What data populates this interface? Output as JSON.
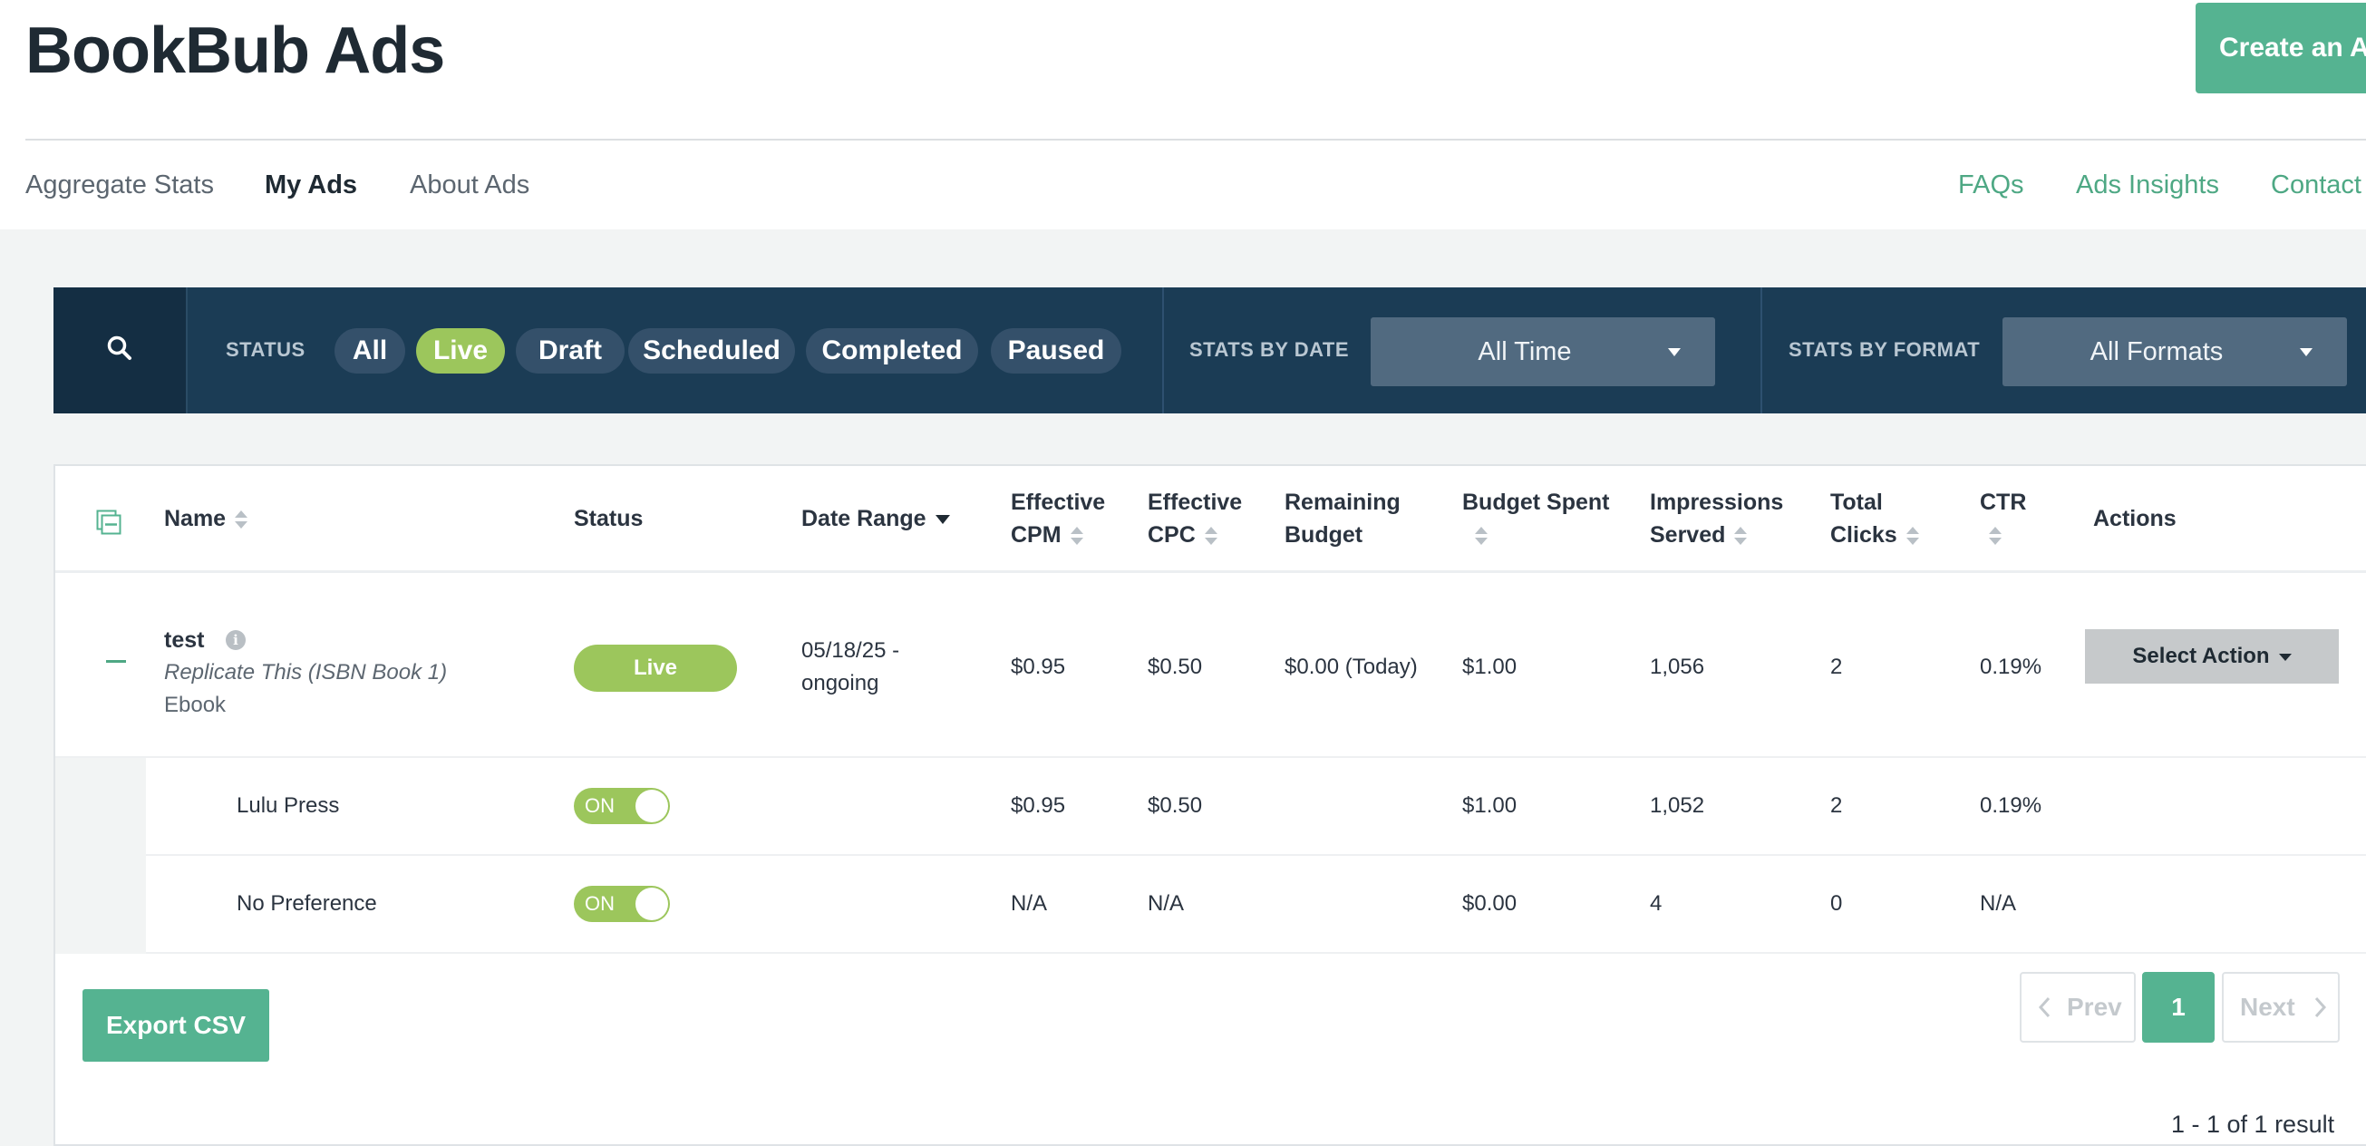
{
  "header": {
    "brand": "BookBub Ads",
    "create_button": "Create an Ad"
  },
  "nav": {
    "left": [
      "Aggregate Stats",
      "My Ads",
      "About Ads"
    ],
    "active": "My Ads",
    "right": [
      "FAQs",
      "Ads Insights",
      "Contact"
    ]
  },
  "filters": {
    "status_label": "STATUS",
    "status_options": [
      "All",
      "Live",
      "Draft",
      "Scheduled",
      "Completed",
      "Paused"
    ],
    "status_selected": "Live",
    "date_label": "STATS BY DATE",
    "date_value": "All Time",
    "format_label": "STATS BY FORMAT",
    "format_value": "All Formats"
  },
  "table": {
    "columns": {
      "name": "Name",
      "status": "Status",
      "date_range": "Date Range",
      "cpm_1": "Effective",
      "cpm_2": "CPM",
      "cpc_1": "Effective",
      "cpc_2": "CPC",
      "remaining_1": "Remaining",
      "remaining_2": "Budget",
      "spent": "Budget Spent",
      "impr_1": "Impressions",
      "impr_2": "Served",
      "clicks_1": "Total",
      "clicks_2": "Clicks",
      "ctr": "CTR",
      "actions": "Actions"
    },
    "ad": {
      "name": "test",
      "book": "Replicate This (ISBN Book 1)",
      "format": "Ebook",
      "status": "Live",
      "date_range_1": "05/18/25 -",
      "date_range_2": "ongoing",
      "cpm": "$0.95",
      "cpc": "$0.50",
      "remaining": "$0.00 (Today)",
      "spent": "$1.00",
      "impressions": "1,056",
      "clicks": "2",
      "ctr": "0.19%",
      "action": "Select Action"
    },
    "sub_rows": [
      {
        "name": "Lulu Press",
        "toggle": "ON",
        "cpm": "$0.95",
        "cpc": "$0.50",
        "spent": "$1.00",
        "impressions": "1,052",
        "clicks": "2",
        "ctr": "0.19%"
      },
      {
        "name": "No Preference",
        "toggle": "ON",
        "cpm": "N/A",
        "cpc": "N/A",
        "spent": "$0.00",
        "impressions": "4",
        "clicks": "0",
        "ctr": "N/A"
      }
    ]
  },
  "footer": {
    "export_label": "Export CSV",
    "prev_label": "Prev",
    "page": "1",
    "next_label": "Next",
    "result_text": "1 - 1 of 1 result"
  },
  "colors": {
    "accent_green": "#55b391",
    "live_green": "#9cc65c",
    "navbar_navy": "#1b3c55"
  }
}
